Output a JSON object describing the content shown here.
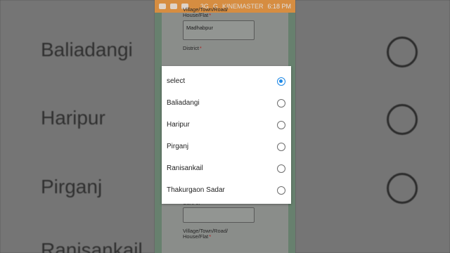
{
  "status_bar": {
    "network": "3G",
    "signal_letter": "G",
    "time": "6:18 PM",
    "overlay_text": "KINEMASTER"
  },
  "form_behind": {
    "top_label": "Village/Town/Road/",
    "top_label_line2": "House/Flat",
    "top_value": "Madhabpur",
    "district_label": "District",
    "care_of_label": "Care of",
    "bottom_label": "Village/Town/Road/",
    "bottom_label_line2": "House/Flat"
  },
  "dialog": {
    "selected_index": 0,
    "options": [
      {
        "label": "select"
      },
      {
        "label": "Baliadangi"
      },
      {
        "label": "Haripur"
      },
      {
        "label": "Pirganj"
      },
      {
        "label": "Ranisankail"
      },
      {
        "label": "Thakurgaon Sadar"
      }
    ]
  },
  "background_zoom": {
    "rows": [
      {
        "label": "Baliadangi"
      },
      {
        "label": "Haripur"
      },
      {
        "label": "Pirganj"
      },
      {
        "label": "Ranisankail"
      }
    ]
  },
  "colors": {
    "status_bar": "#f4a14b",
    "radio_selected": "#1e88e5",
    "dialog_bg": "#ffffff",
    "page_bg": "#9ea19e"
  }
}
